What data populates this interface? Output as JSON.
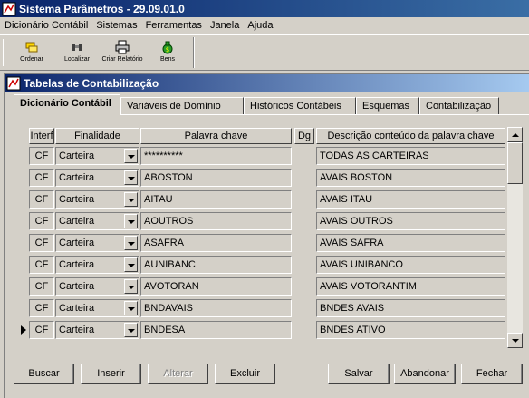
{
  "window": {
    "title": "Sistema Parâmetros - 29.09.01.0"
  },
  "menu": {
    "items": [
      "Dicionário Contábil",
      "Sistemas",
      "Ferramentas",
      "Janela",
      "Ajuda"
    ]
  },
  "toolbar": {
    "buttons": [
      "Ordenar",
      "Localizar",
      "Criar Relatório",
      "Bens"
    ]
  },
  "child": {
    "title": "Tabelas de Contabilização"
  },
  "tabs": [
    "Dicionário Contábil",
    "Variáveis de Domínio",
    "Históricos Contábeis",
    "Esquemas",
    "Contabilização"
  ],
  "grid": {
    "headers": [
      "Interf",
      "Finalidade",
      "Palavra chave",
      "Dg",
      "Descrição conteúdo da palavra chave"
    ],
    "rows": [
      {
        "interf": "CF",
        "finalidade": "Carteira",
        "palavra": "**********",
        "dg": "",
        "descricao": "TODAS AS CARTEIRAS"
      },
      {
        "interf": "CF",
        "finalidade": "Carteira",
        "palavra": "ABOSTON",
        "dg": "",
        "descricao": "AVAIS BOSTON"
      },
      {
        "interf": "CF",
        "finalidade": "Carteira",
        "palavra": "AITAU",
        "dg": "",
        "descricao": "AVAIS ITAU"
      },
      {
        "interf": "CF",
        "finalidade": "Carteira",
        "palavra": "AOUTROS",
        "dg": "",
        "descricao": "AVAIS OUTROS"
      },
      {
        "interf": "CF",
        "finalidade": "Carteira",
        "palavra": "ASAFRA",
        "dg": "",
        "descricao": "AVAIS SAFRA"
      },
      {
        "interf": "CF",
        "finalidade": "Carteira",
        "palavra": "AUNIBANC",
        "dg": "",
        "descricao": "AVAIS UNIBANCO"
      },
      {
        "interf": "CF",
        "finalidade": "Carteira",
        "palavra": "AVOTORAN",
        "dg": "",
        "descricao": "AVAIS VOTORANTIM"
      },
      {
        "interf": "CF",
        "finalidade": "Carteira",
        "palavra": "BNDAVAIS",
        "dg": "",
        "descricao": "BNDES AVAIS"
      },
      {
        "interf": "CF",
        "finalidade": "Carteira",
        "palavra": "BNDESA",
        "dg": "",
        "descricao": "BNDES ATIVO"
      }
    ]
  },
  "buttons": {
    "buscar": "Buscar",
    "inserir": "Inserir",
    "alterar": "Alterar",
    "excluir": "Excluir",
    "salvar": "Salvar",
    "abandonar": "Abandonar",
    "fechar": "Fechar"
  },
  "colors": {
    "title_bar": "#0a246a",
    "face": "#d4d0c8"
  }
}
